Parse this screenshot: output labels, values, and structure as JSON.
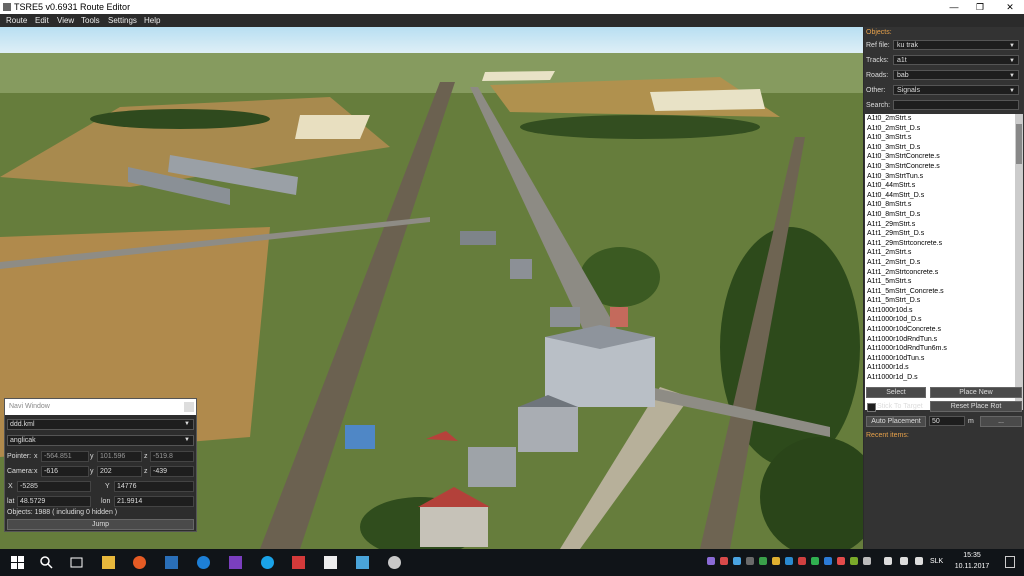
{
  "window": {
    "title": "TSRE5 v0.6931 Route Editor"
  },
  "menu": [
    "Route",
    "Edit",
    "View",
    "Tools",
    "Settings",
    "Help"
  ],
  "objects_panel": {
    "header": "Objects:",
    "ref_file": {
      "label": "Ref file:",
      "value": "ku trak"
    },
    "tracks": {
      "label": "Tracks:",
      "value": "a1t"
    },
    "roads": {
      "label": "Roads:",
      "value": "bab"
    },
    "other": {
      "label": "Other:",
      "value": "Signals"
    },
    "search_label": "Search:",
    "files": [
      "A1t0_2mStrt.s",
      "A1t0_2mStrt_D.s",
      "A1t0_3mStrt.s",
      "A1t0_3mStrt_D.s",
      "A1t0_3mStrtConcrete.s",
      "A1t0_3mStrtConcrete.s",
      "A1t0_3mStrtTun.s",
      "A1t0_44mStrt.s",
      "A1t0_44mStrt_D.s",
      "A1t0_8mStrt.s",
      "A1t0_8mStrt_D.s",
      "A1t1_29mStrt.s",
      "A1t1_29mStrt_D.s",
      "A1t1_29mStrtconcrete.s",
      "A1t1_2mStrt.s",
      "A1t1_2mStrt_D.s",
      "A1t1_2mStrtconcrete.s",
      "A1t1_5mStrt.s",
      "A1t1_5mStrt_Concrete.s",
      "A1t1_5mStrt_D.s",
      "A1t1000r10d.s",
      "A1t1000r10d_D.s",
      "A1t1000r10dConcrete.s",
      "A1t1000r10dRndTun.s",
      "A1t1000r10dRndTun6m.s",
      "A1t1000r10dTun.s",
      "A1t1000r1d.s",
      "A1t1000r1d_D.s"
    ],
    "select_btn": "Select",
    "place_new_btn": "Place New",
    "stick_to_target": "Stick To Target",
    "reset_place_rot_btn": "Reset Place Rot",
    "auto_placement_btn": "Auto Placement",
    "distance_value": "50",
    "distance_unit": "m",
    "more_btn": "...",
    "recent_items": "Recent items:"
  },
  "navi": {
    "title": "Navi Window",
    "file": "ddd.kml",
    "language": "anglicak",
    "pointer_label": "Pointer:",
    "pointer": {
      "x": "-564.851",
      "y": "101.596",
      "z": "-519.8"
    },
    "camera_label": "Camera:",
    "camera": {
      "x": "-616",
      "y": "202",
      "z": "-439"
    },
    "tile": {
      "x": "-5285",
      "y": "14776"
    },
    "lat": "48.5729",
    "lon": "21.9914",
    "objects_status": "Objects: 1988 ( including 0 hidden )",
    "jump_btn": "Jump",
    "labels": {
      "x": "x",
      "y": "y",
      "z": "z",
      "X": "X",
      "Y": "Y",
      "lat": "lat",
      "lon": "lon"
    }
  },
  "taskbar": {
    "lang": "SLK",
    "time": "15:35",
    "date": "10.11.2017"
  }
}
